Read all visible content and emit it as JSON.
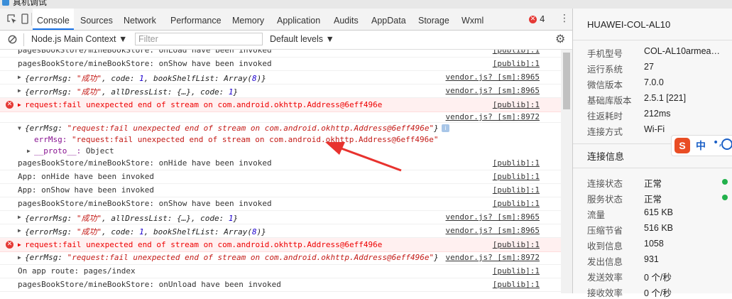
{
  "window": {
    "title": "真机调试"
  },
  "tabs": [
    "Console",
    "Sources",
    "Network",
    "Performance",
    "Memory",
    "Application",
    "Audits",
    "AppData",
    "Storage",
    "Wxml"
  ],
  "error_count": "4",
  "filterbar": {
    "context": "Node.js Main Context",
    "filter_placeholder": "Filter",
    "levels": "Default levels"
  },
  "console": {
    "rows": [
      {
        "type": "log",
        "text": "pagesBookStore/mineBookStore: onLoad have been invoked",
        "src": "[publib]:1"
      },
      {
        "type": "log",
        "text": "pagesBookStore/mineBookStore: onShow have been invoked",
        "src": "[publib]:1"
      },
      {
        "type": "obj",
        "text": "{errorMsg: \"成功\", code: 1, bookShelfList: Array(8)}",
        "src": "vendor.js? [sm]:8965"
      },
      {
        "type": "obj",
        "text": "{errorMsg: \"成功\", allDressList: {…}, code: 1}",
        "src": "vendor.js? [sm]:8965"
      },
      {
        "type": "error",
        "text": "request:fail unexpected end of stream on com.android.okhttp.Address@6eff496e",
        "src": "[publib]:1"
      },
      {
        "type": "src",
        "text": "",
        "src": "vendor.js? [sm]:8972"
      },
      {
        "type": "obj-open",
        "text": "{errMsg: \"request:fail unexpected end of stream on com.android.okhttp.Address@6eff496e\"}",
        "src": ""
      },
      {
        "type": "prop",
        "text": "errMsg: \"request:fail unexpected end of stream on com.android.okhttp.Address@6eff496e\"",
        "src": ""
      },
      {
        "type": "proto",
        "text": "__proto__: Object",
        "src": ""
      },
      {
        "type": "log",
        "text": "pagesBookStore/mineBookStore: onHide have been invoked",
        "src": "[publib]:1"
      },
      {
        "type": "log",
        "text": "App: onHide have been invoked",
        "src": "[publib]:1"
      },
      {
        "type": "log",
        "text": "App: onShow have been invoked",
        "src": "[publib]:1"
      },
      {
        "type": "log",
        "text": "pagesBookStore/mineBookStore: onShow have been invoked",
        "src": "[publib]:1"
      },
      {
        "type": "obj",
        "text": "{errorMsg: \"成功\", allDressList: {…}, code: 1}",
        "src": "vendor.js? [sm]:8965"
      },
      {
        "type": "obj",
        "text": "{errorMsg: \"成功\", code: 1, bookShelfList: Array(8)}",
        "src": "vendor.js? [sm]:8965"
      },
      {
        "type": "error",
        "text": "request:fail unexpected end of stream on com.android.okhttp.Address@6eff496e",
        "src": "[publib]:1"
      },
      {
        "type": "obj",
        "text": "{errMsg: \"request:fail unexpected end of stream on com.android.okhttp.Address@6eff496e\"}",
        "src": "vendor.js? [sm]:8972"
      },
      {
        "type": "log",
        "text": "On app route: pages/index",
        "src": "[publib]:1"
      },
      {
        "type": "log",
        "text": "pagesBookStore/mineBookStore: onUnload have been invoked",
        "src": "[publib]:1"
      }
    ]
  },
  "device": {
    "name": "HUAWEI-COL-AL10",
    "info": [
      {
        "k": "手机型号",
        "v": "COL-AL10armea…"
      },
      {
        "k": "运行系统",
        "v": "27"
      },
      {
        "k": "微信版本",
        "v": "7.0.0"
      },
      {
        "k": "基础库版本",
        "v": "2.5.1 [221]"
      },
      {
        "k": "往返耗时",
        "v": "212ms"
      },
      {
        "k": "连接方式",
        "v": "Wi-Fi"
      }
    ]
  },
  "connection": {
    "title": "连接信息",
    "info": [
      {
        "k": "连接状态",
        "v": "正常"
      },
      {
        "k": "服务状态",
        "v": "正常"
      },
      {
        "k": "流量",
        "v": "615 KB"
      },
      {
        "k": "压缩节省",
        "v": "516 KB"
      },
      {
        "k": "收到信息",
        "v": "1058"
      },
      {
        "k": "发出信息",
        "v": "931"
      },
      {
        "k": "发送效率",
        "v": "0 个/秒"
      },
      {
        "k": "接收效率",
        "v": "0 个/秒"
      }
    ]
  },
  "ime": {
    "logo": "S",
    "lang": "中",
    "punct": "•,"
  },
  "colors": {
    "accent": "#1a73e8",
    "error": "#e53935",
    "ok": "#22b14c",
    "arrow": "#e8322e"
  }
}
